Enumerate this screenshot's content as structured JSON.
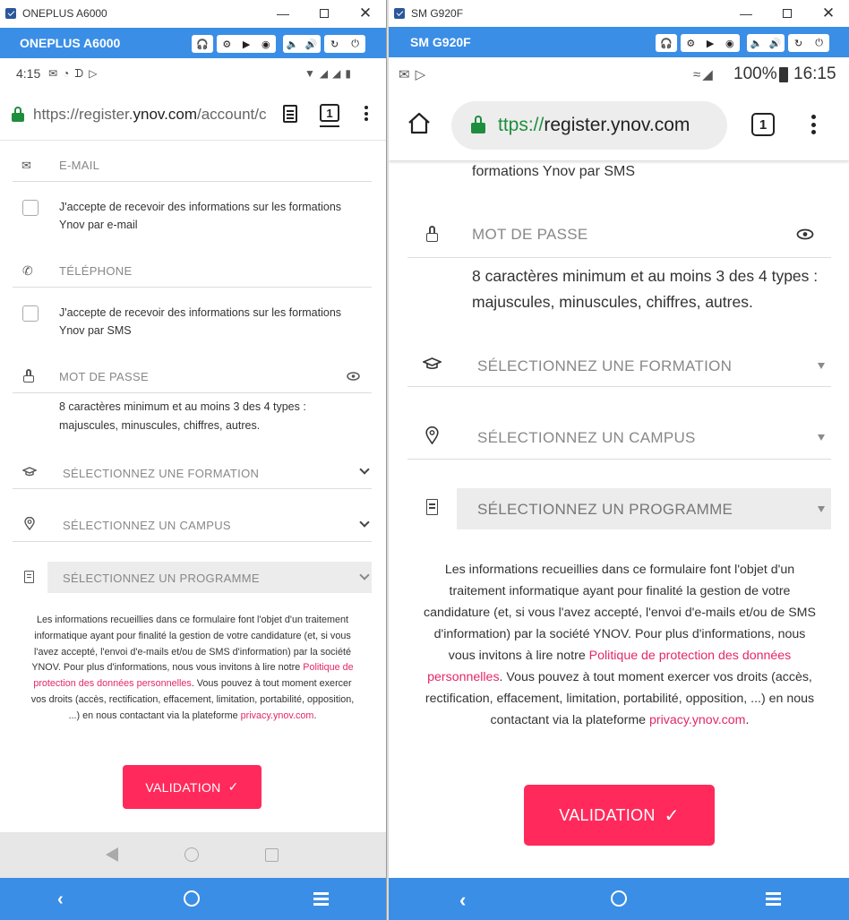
{
  "left": {
    "window_title": "ONEPLUS A6000",
    "device_name": "ONEPLUS A6000",
    "toolbar_icons": [
      "headphones-icon",
      "gear-icon",
      "video-icon",
      "camera-icon",
      "volume-down-icon",
      "volume-up-icon",
      "rotate-icon",
      "power-icon"
    ],
    "status": {
      "time": "4:15"
    },
    "url": {
      "prefix": "https://register.",
      "domain": "ynov.com",
      "suffix": "/account/c"
    },
    "tab_count": "1",
    "fields": {
      "email": "E-MAIL",
      "consent_email": "J'accepte de recevoir des informations sur les formations Ynov par e-mail",
      "phone": "TÉLÉPHONE",
      "consent_sms": "J'accepte de recevoir des informations sur les formations Ynov par SMS",
      "password": "MOT DE PASSE",
      "password_hint": "8 caractères minimum et au moins 3 des 4 types : majuscules, minuscules, chiffres, autres.",
      "formation": "SÉLECTIONNEZ UNE FORMATION",
      "campus": "SÉLECTIONNEZ UN CAMPUS",
      "programme": "SÉLECTIONNEZ UN PROGRAMME"
    },
    "legal": {
      "part1": "Les informations recueillies dans ce formulaire font l'objet d'un traitement informatique ayant pour finalité la gestion de votre candidature (et, si vous l'avez accepté, l'envoi d'e-mails et/ou de SMS d'information) par la société YNOV. Pour plus d'informations, nous vous invitons à lire notre ",
      "link_policy": "Politique de protection des données personnelles",
      "part2": ". Vous pouvez à tout moment exercer vos droits (accès, rectification, effacement, limitation, portabilité, opposition, ...) en nous contactant via la plateforme ",
      "link_privacy": "privacy.ynov.com",
      "part3": "."
    },
    "validate_label": "VALIDATION"
  },
  "right": {
    "window_title": "SM G920F",
    "device_name": "SM G920F",
    "toolbar_icons": [
      "headphones-icon",
      "gear-icon",
      "video-icon",
      "camera-icon",
      "volume-down-icon",
      "volume-up-icon",
      "rotate-icon",
      "power-icon"
    ],
    "status": {
      "battery": "100%",
      "time": "16:15"
    },
    "url": {
      "prefix": "ttps://",
      "domain": "register.ynov.com"
    },
    "tab_count": "1",
    "fields": {
      "sms_tail": "formations Ynov par SMS",
      "password": "MOT DE PASSE",
      "password_hint": "8 caractères minimum et au moins 3 des 4 types : majuscules, minuscules, chiffres, autres.",
      "formation": "SÉLECTIONNEZ UNE FORMATION",
      "campus": "SÉLECTIONNEZ UN CAMPUS",
      "programme": "SÉLECTIONNEZ UN PROGRAMME"
    },
    "legal": {
      "part1": "Les informations recueillies dans ce formulaire font l'objet d'un traitement informatique ayant pour finalité la gestion de votre candidature (et, si vous l'avez accepté, l'envoi d'e-mails et/ou de SMS d'information) par la société YNOV. Pour plus d'informations, nous vous invitons à lire notre ",
      "link_policy": "Politique de protection des données personnelles",
      "part2": ". Vous pouvez à tout moment exercer vos droits (accès, rectification, effacement, limitation, portabilité, opposition, ...) en nous contactant via la plateforme ",
      "link_privacy": "privacy.ynov.com",
      "part3": "."
    },
    "validate_label": "VALIDATION"
  },
  "colors": {
    "accent_blue": "#3a8ee6",
    "validate_pink": "#ff2a5b",
    "link_pink": "#e4276a",
    "lock_green": "#1e8e3e"
  }
}
